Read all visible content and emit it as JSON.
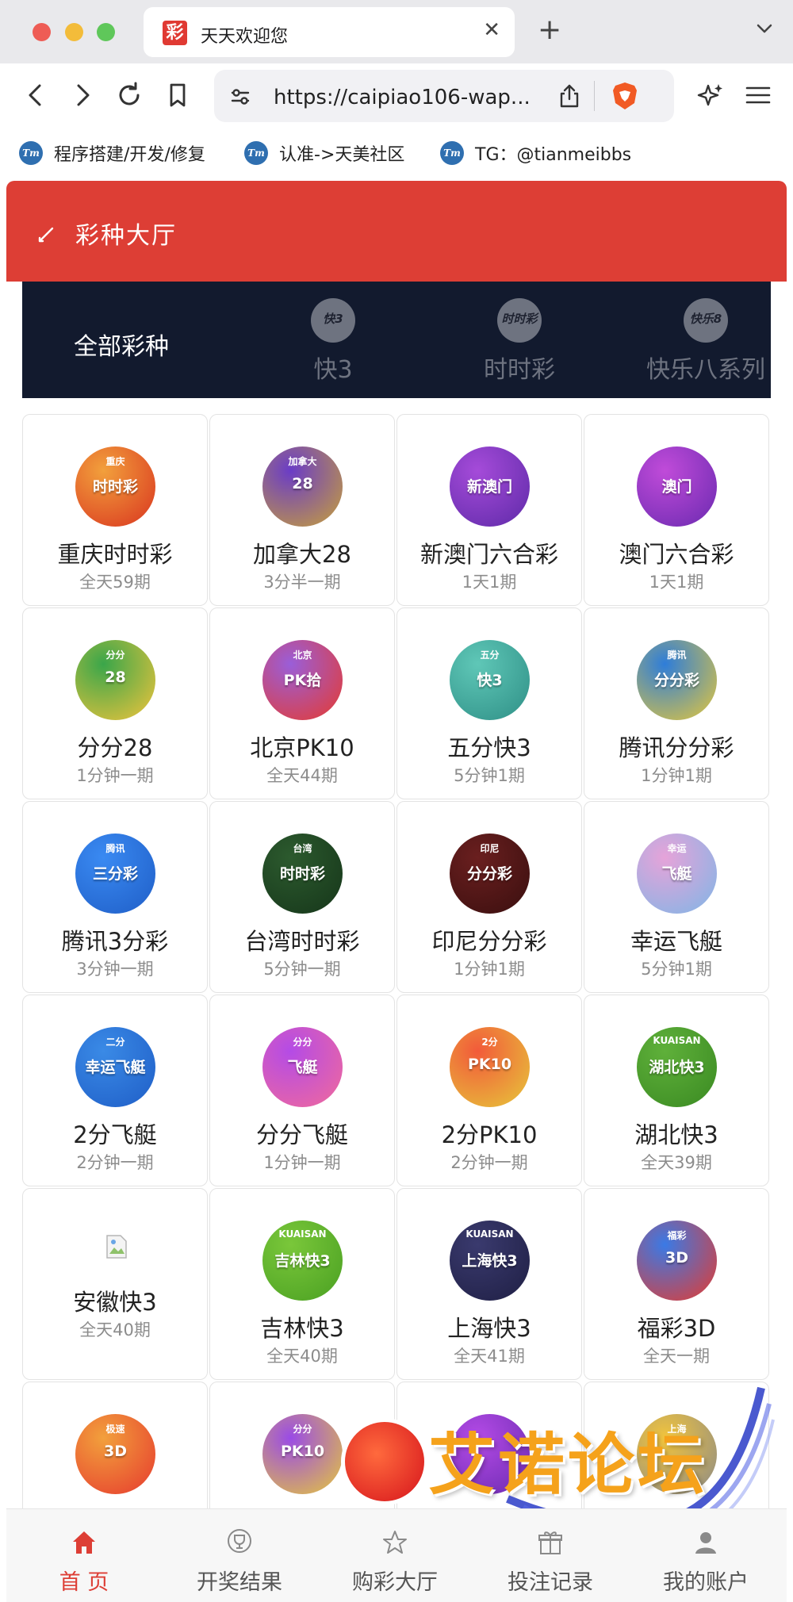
{
  "browser": {
    "tab_title": "天天欢迎您",
    "tab_favicon_char": "彩",
    "url": "https://caipiao106-wap...",
    "bookmarks": [
      {
        "label": "程序搭建/开发/修复",
        "icon_text": "Tm"
      },
      {
        "label": "认准->天美社区",
        "icon_text": "Tm"
      },
      {
        "label": "TG：@tianmeibbs",
        "icon_text": "Tm"
      }
    ]
  },
  "colors": {
    "header": "#dd3e35",
    "category_bar": "#121a2e",
    "active_nav": "#dd3e35"
  },
  "page": {
    "title": "彩种大厅"
  },
  "categories": [
    {
      "label": "全部彩种",
      "icon_text": "",
      "active": true
    },
    {
      "label": "快3",
      "icon_text": "快3",
      "active": false
    },
    {
      "label": "时时彩",
      "icon_text": "时时彩",
      "active": false
    },
    {
      "label": "快乐八系列",
      "icon_text": "快乐8",
      "active": false
    }
  ],
  "lotteries": [
    {
      "name": "重庆时时彩",
      "freq": "全天59期",
      "logo": "时时彩",
      "logo_sub": "重庆",
      "bg": "#f2a03c",
      "bg2": "#d9341f"
    },
    {
      "name": "加拿大28",
      "freq": "3分半一期",
      "logo": "28",
      "logo_sub": "加拿大",
      "bg": "#6a3cc7",
      "bg2": "#c8a138"
    },
    {
      "name": "新澳门六合彩",
      "freq": "1天1期",
      "logo": "新澳门",
      "logo_sub": "",
      "bg": "#a54bd9",
      "bg2": "#5e2aa8"
    },
    {
      "name": "澳门六合彩",
      "freq": "1天1期",
      "logo": "澳门",
      "logo_sub": "",
      "bg": "#c04bd9",
      "bg2": "#6a2ab0"
    },
    {
      "name": "分分28",
      "freq": "1分钟一期",
      "logo": "28",
      "logo_sub": "分分",
      "bg": "#3aa64a",
      "bg2": "#f2c43c"
    },
    {
      "name": "北京PK10",
      "freq": "全天44期",
      "logo": "PK拾",
      "logo_sub": "北京",
      "bg": "#9a5ed9",
      "bg2": "#e63a2e"
    },
    {
      "name": "五分快3",
      "freq": "5分钟1期",
      "logo": "快3",
      "logo_sub": "五分",
      "bg": "#5fc7b7",
      "bg2": "#2e8f86"
    },
    {
      "name": "腾讯分分彩",
      "freq": "1分钟1期",
      "logo": "分分彩",
      "logo_sub": "腾讯",
      "bg": "#2e7dd9",
      "bg2": "#e6c83a"
    },
    {
      "name": "腾讯3分彩",
      "freq": "3分钟一期",
      "logo": "三分彩",
      "logo_sub": "腾讯",
      "bg": "#3a8af2",
      "bg2": "#1f5ec7"
    },
    {
      "name": "台湾时时彩",
      "freq": "5分钟一期",
      "logo": "时时彩",
      "logo_sub": "台湾",
      "bg": "#2c5a2e",
      "bg2": "#16361a"
    },
    {
      "name": "印尼分分彩",
      "freq": "1分钟1期",
      "logo": "分分彩",
      "logo_sub": "印尼",
      "bg": "#6a1f1f",
      "bg2": "#3a0f0f"
    },
    {
      "name": "幸运飞艇",
      "freq": "5分钟1期",
      "logo": "飞艇",
      "logo_sub": "幸运",
      "bg": "#e6a3d9",
      "bg2": "#7fb6e6"
    },
    {
      "name": "2分飞艇",
      "freq": "2分钟一期",
      "logo": "幸运飞艇",
      "logo_sub": "二分",
      "bg": "#3a8ae6",
      "bg2": "#1f5ec7"
    },
    {
      "name": "分分飞艇",
      "freq": "1分钟一期",
      "logo": "飞艇",
      "logo_sub": "分分",
      "bg": "#b44be6",
      "bg2": "#f26a9a"
    },
    {
      "name": "2分PK10",
      "freq": "2分钟一期",
      "logo": "PK10",
      "logo_sub": "2分",
      "bg": "#f25a3a",
      "bg2": "#e6c83a"
    },
    {
      "name": "湖北快3",
      "freq": "全天39期",
      "logo": "湖北快3",
      "logo_sub": "KUAISAN",
      "bg": "#5fb03a",
      "bg2": "#3a8a22"
    },
    {
      "name": "安徽快3",
      "freq": "全天40期",
      "logo": "",
      "logo_sub": "",
      "bg": "",
      "bg2": "",
      "broken": true
    },
    {
      "name": "吉林快3",
      "freq": "全天40期",
      "logo": "吉林快3",
      "logo_sub": "KUAISAN",
      "bg": "#7ac73a",
      "bg2": "#4aa022"
    },
    {
      "name": "上海快3",
      "freq": "全天41期",
      "logo": "上海快3",
      "logo_sub": "KUAISAN",
      "bg": "#3a3a6e",
      "bg2": "#1f1f44"
    },
    {
      "name": "福彩3D",
      "freq": "全天一期",
      "logo": "3D",
      "logo_sub": "福彩",
      "bg": "#3a7ae6",
      "bg2": "#e63a2e"
    },
    {
      "name": "",
      "freq": "",
      "logo": "3D",
      "logo_sub": "极速",
      "bg": "#f2a03c",
      "bg2": "#e63a2e"
    },
    {
      "name": "",
      "freq": "",
      "logo": "PK10",
      "logo_sub": "分分",
      "bg": "#9a4be6",
      "bg2": "#e6c83a"
    },
    {
      "name": "",
      "freq": "",
      "logo": "",
      "logo_sub": "",
      "bg": "#b44be6",
      "bg2": "#6a2ab0"
    },
    {
      "name": "",
      "freq": "",
      "logo": "",
      "logo_sub": "上海",
      "bg": "#f2c43c",
      "bg2": "#8a8a8a"
    }
  ],
  "watermark": {
    "text": "艾诺论坛",
    "url": "ainuo.it.com"
  },
  "bottom_nav": [
    {
      "label": "首 页",
      "icon": "home-icon",
      "active": true
    },
    {
      "label": "开奖结果",
      "icon": "trophy-icon",
      "active": false
    },
    {
      "label": "购彩大厅",
      "icon": "star-icon",
      "active": false
    },
    {
      "label": "投注记录",
      "icon": "gift-icon",
      "active": false
    },
    {
      "label": "我的账户",
      "icon": "user-icon",
      "active": false
    }
  ]
}
